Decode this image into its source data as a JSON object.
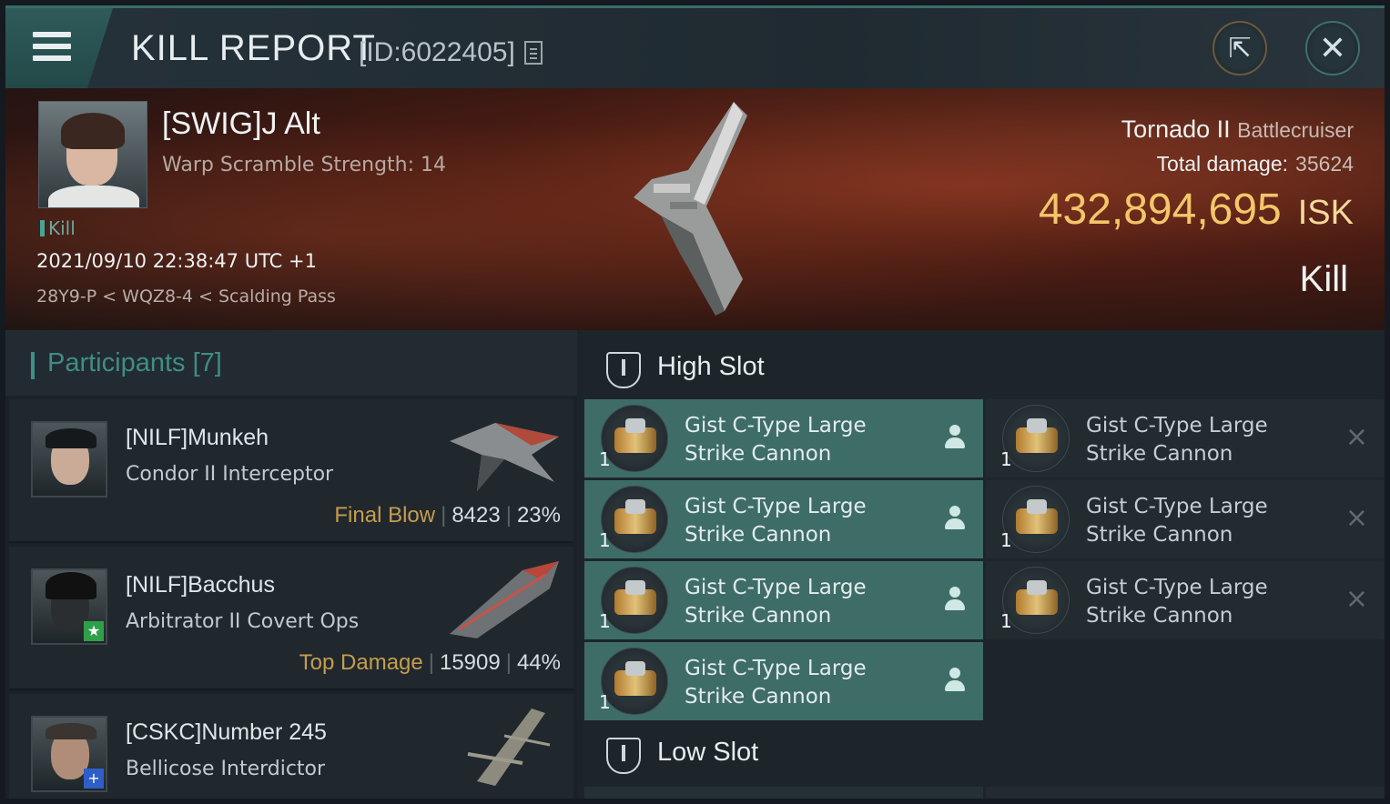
{
  "header": {
    "title": "KILL REPORT",
    "report_id": "[ID:6022405]",
    "export_icon": "export-icon",
    "close_icon": "close-icon",
    "accent": "#2f5b5b"
  },
  "victim": {
    "name": "[SWIG]J Alt",
    "subtitle": "Warp Scramble Strength: 14",
    "kill_tag": "Kill",
    "datetime": "2021/09/10 22:38:47 UTC +1",
    "location": "28Y9-P < WQZ8-4 < Scalding Pass",
    "ship_name": "Tornado II",
    "ship_class": "Battlecruiser",
    "total_damage_label": "Total damage:",
    "total_damage": "35624",
    "isk_value": "432,894,695",
    "isk_unit": "ISK",
    "result": "Kill",
    "isk_color": "#f4c66a"
  },
  "participants": {
    "header": "Participants [7]",
    "rows": [
      {
        "name": "[NILF]Munkeh",
        "ship": "Condor II Interceptor",
        "tag": "Final Blow",
        "damage": "8423",
        "percent": "23%",
        "badge": ""
      },
      {
        "name": "[NILF]Bacchus",
        "ship": "Arbitrator II Covert Ops",
        "tag": "Top Damage",
        "damage": "15909",
        "percent": "44%",
        "badge": "★"
      },
      {
        "name": "[CSKC]Number 245",
        "ship": "Bellicose Interdictor",
        "tag": "",
        "damage": "",
        "percent": "",
        "badge": "+"
      }
    ]
  },
  "fitting": {
    "high_slot_label": "High Slot",
    "low_slot_label": "Low Slot",
    "high_modules_dropped": [
      {
        "name_line1": "Gist C-Type Large",
        "name_line2": "Strike Cannon",
        "qty": "1"
      },
      {
        "name_line1": "Gist C-Type Large",
        "name_line2": "Strike Cannon",
        "qty": "1"
      },
      {
        "name_line1": "Gist C-Type Large",
        "name_line2": "Strike Cannon",
        "qty": "1"
      },
      {
        "name_line1": "Gist C-Type Large",
        "name_line2": "Strike Cannon",
        "qty": "1"
      }
    ],
    "high_modules_destroyed": [
      {
        "name_line1": "Gist C-Type Large",
        "name_line2": "Strike Cannon",
        "qty": "1",
        "mark": "×"
      },
      {
        "name_line1": "Gist C-Type Large",
        "name_line2": "Strike Cannon",
        "qty": "1",
        "mark": "×"
      },
      {
        "name_line1": "Gist C-Type Large",
        "name_line2": "Strike Cannon",
        "qty": "1",
        "mark": "×"
      }
    ]
  }
}
